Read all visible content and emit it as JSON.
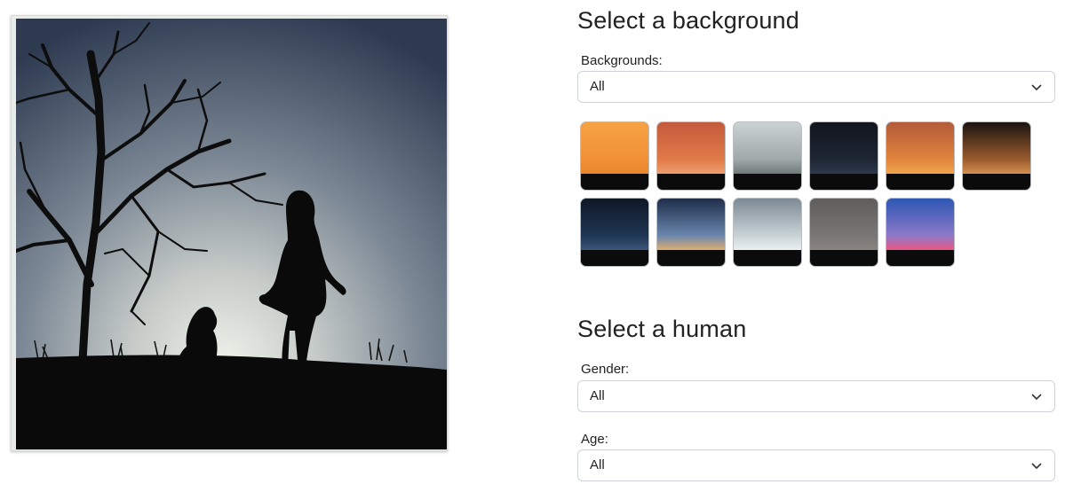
{
  "preview": {
    "alt": "Silhouette of a woman and a dog beneath a bare tree at dusk"
  },
  "background_section": {
    "title": "Select a background",
    "filter_label": "Backgrounds:",
    "filter_value": "All",
    "thumbnails": [
      {
        "name": "orange-sunset",
        "colors": [
          "#f6a244",
          "#f19135",
          "#e8852c"
        ]
      },
      {
        "name": "orange-clouds",
        "colors": [
          "#c35a3c",
          "#e07a48",
          "#f0a272"
        ]
      },
      {
        "name": "bare-tree-pale-sky",
        "colors": [
          "#cbd3d2",
          "#9fa9a7",
          "#6a7574"
        ]
      },
      {
        "name": "night-mountains",
        "colors": [
          "#12151d",
          "#1e2634",
          "#2f3a4e"
        ]
      },
      {
        "name": "orange-sky-tree",
        "colors": [
          "#b35b3a",
          "#e1843d",
          "#f1a84c"
        ]
      },
      {
        "name": "orange-moon",
        "colors": [
          "#1a1410",
          "#9a5b2d",
          "#d99454"
        ]
      },
      {
        "name": "full-moon-clouds",
        "colors": [
          "#0e1726",
          "#1f3653",
          "#3c587b"
        ]
      },
      {
        "name": "dusk-horizon",
        "colors": [
          "#1f2d4a",
          "#6a87ae",
          "#e7b26d"
        ]
      },
      {
        "name": "light-rays-fog",
        "colors": [
          "#7d8994",
          "#c9d3d7",
          "#eef2f3"
        ]
      },
      {
        "name": "misty-gray",
        "colors": [
          "#5e5d5c",
          "#7a7674",
          "#8a8583"
        ]
      },
      {
        "name": "pink-blue-sunset",
        "colors": [
          "#2d57b4",
          "#8c79c8",
          "#f2547e"
        ]
      }
    ]
  },
  "human_section": {
    "title": "Select a human",
    "gender_label": "Gender:",
    "gender_value": "All",
    "age_label": "Age:",
    "age_value": "All"
  },
  "icons": {
    "dropdown": "chevron-down-icon"
  }
}
